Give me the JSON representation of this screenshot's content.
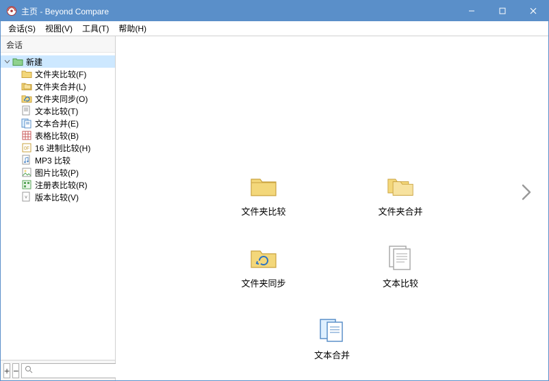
{
  "window": {
    "title": "主页 - Beyond Compare"
  },
  "menubar": {
    "items": [
      "会话(S)",
      "视图(V)",
      "工具(T)",
      "帮助(H)"
    ]
  },
  "sidebar": {
    "header": "会话",
    "root_label": "新建",
    "items": [
      {
        "label": "文件夹比较(F)",
        "icon": "folder"
      },
      {
        "label": "文件夹合并(L)",
        "icon": "folder-merge"
      },
      {
        "label": "文件夹同步(O)",
        "icon": "folder-sync"
      },
      {
        "label": "文本比较(T)",
        "icon": "text"
      },
      {
        "label": "文本合并(E)",
        "icon": "text-merge"
      },
      {
        "label": "表格比较(B)",
        "icon": "table"
      },
      {
        "label": "16 进制比较(H)",
        "icon": "hex"
      },
      {
        "label": "MP3 比较",
        "icon": "mp3"
      },
      {
        "label": "图片比较(P)",
        "icon": "picture"
      },
      {
        "label": "注册表比较(R)",
        "icon": "registry"
      },
      {
        "label": "版本比较(V)",
        "icon": "version"
      }
    ],
    "bottom": {
      "add_label": "+",
      "remove_label": "−",
      "search_placeholder": ""
    }
  },
  "main": {
    "tiles": [
      {
        "label": "文件夹比较",
        "icon": "folder"
      },
      {
        "label": "文件夹合并",
        "icon": "folder-merge"
      },
      {
        "label": "文件夹同步",
        "icon": "folder-sync"
      },
      {
        "label": "文本比较",
        "icon": "text"
      },
      {
        "label": "文本合并",
        "icon": "text-merge"
      }
    ]
  },
  "colors": {
    "titlebar": "#5a8fc9",
    "selection": "#cde8ff",
    "folder_fill": "#f3d77a",
    "folder_stroke": "#c9a23e"
  }
}
